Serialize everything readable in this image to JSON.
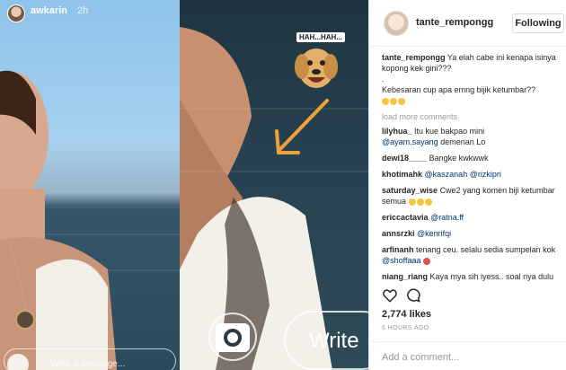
{
  "story": {
    "username": "awkarin",
    "time": "2h",
    "message_placeholder": "Write a message...",
    "write_label": "Write",
    "sticker_text": "HAH...HAH...",
    "arrow_color": "#f0a23a"
  },
  "post": {
    "author": "tante_rempongg",
    "follow_label": "Following",
    "caption_lines": [
      "Ya elah cabe ini kenapa isinya kopong kek gini???",
      ".",
      "Kebesaran cup apa emng bijik ketumbar??"
    ],
    "load_more": "load more comments",
    "comments": [
      {
        "user": "lilyhua_",
        "text": "Itu kue bakpao mini",
        "mention": "@ayam.sayang",
        "after": "demenan Lo"
      },
      {
        "user": "dewi18____",
        "text": "Bangke kwkwwk"
      },
      {
        "user": "khotimahk",
        "mention": "@kaszanah",
        "mention2": "@rizkipri"
      },
      {
        "user": "saturday_wise",
        "text": "Cwe2 yang komen biji ketumbar semua"
      },
      {
        "user": "ericcactavia",
        "mention": "@ratna.ff"
      },
      {
        "user": "annsrzki",
        "mention": "@kenrifqi"
      },
      {
        "user": "arfinanh",
        "text": "tenang ceu. selalu sedia sumpelan kok",
        "mention": "@shoffaaa"
      },
      {
        "user": "niang_riang",
        "text": "Kaya mya sih iyess.. soal nya dulu kan rata kaya papan penggilesan"
      }
    ],
    "likes": "2,774 likes",
    "posted": "6 HOURS AGO",
    "add_comment_placeholder": "Add a comment..."
  },
  "icons": {
    "heart": "heart-icon",
    "comment": "comment-icon",
    "camera": "camera-icon"
  }
}
